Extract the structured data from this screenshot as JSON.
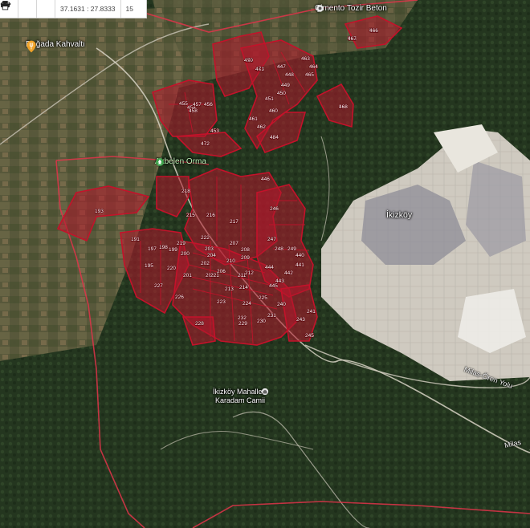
{
  "toolbar": {
    "star_icon": "star-icon",
    "measure_icon": "ruler-arrows-icon",
    "print_icon": "print-icon",
    "coordinates": "37.1631 : 27.8333",
    "zoom": "15"
  },
  "places": {
    "cimento": "Çimento Tozir Beton",
    "dogada": "Doğada Kahvaltı",
    "akbelen": "Akbelen Orma",
    "ikizkoy": "İkizköy",
    "mahalle_line1": "İkizköy Mahallesi",
    "mahalle_line2": "Karadam Camii",
    "road1": "Milas-Ören Yolu",
    "road2": "Milas"
  },
  "parcels": [
    "512",
    "513",
    "514",
    "452",
    "483",
    "484",
    "472",
    "453",
    "454",
    "455",
    "458",
    "457",
    "456",
    "193",
    "191",
    "195",
    "197",
    "198",
    "199",
    "200",
    "201",
    "202",
    "203",
    "204",
    "205",
    "206",
    "207",
    "208",
    "209",
    "210",
    "211",
    "212",
    "213",
    "214",
    "215",
    "216",
    "217",
    "218",
    "219",
    "220",
    "221",
    "222",
    "223",
    "224",
    "225",
    "226",
    "227",
    "228",
    "229",
    "230",
    "231",
    "232",
    "240",
    "241",
    "243",
    "245",
    "246",
    "247",
    "248",
    "249",
    "440",
    "441",
    "442",
    "443",
    "444",
    "445",
    "446",
    "447",
    "448",
    "449",
    "450",
    "451",
    "460",
    "461",
    "462",
    "463",
    "464",
    "465",
    "466",
    "467",
    "468",
    "470",
    "471"
  ],
  "colors": {
    "parcel_fill": "#b3172b",
    "parcel_stroke": "#c4122a",
    "boundary": "#e0344a",
    "mine": "#d9d4c8"
  }
}
